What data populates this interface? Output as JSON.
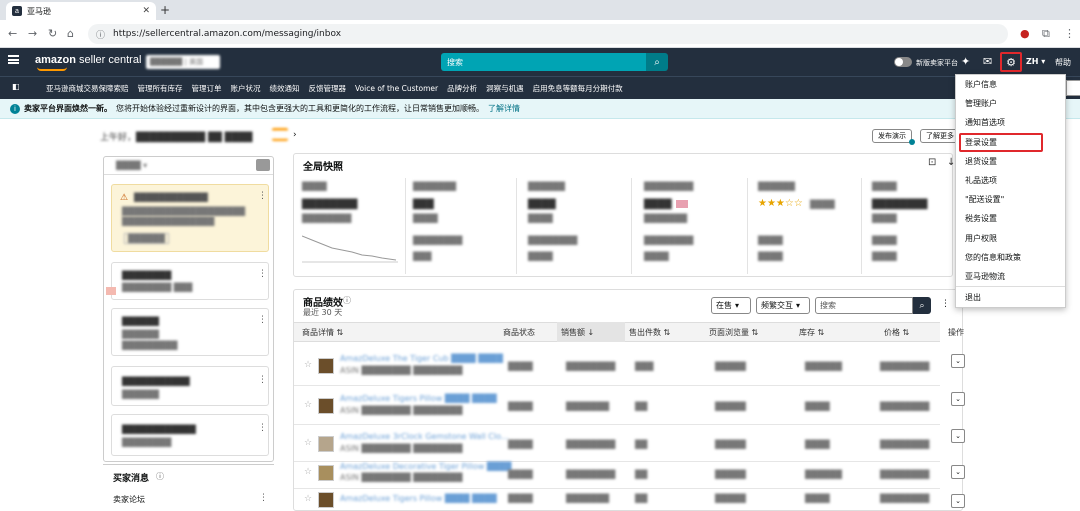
{
  "browser": {
    "tab_title": "亚马逊",
    "url": "https://sellercentral.amazon.com/messaging/inbox"
  },
  "header": {
    "logo_main": "amazon",
    "logo_sub": " seller central",
    "store_selector": "██████ | 美国",
    "search_placeholder": "搜索",
    "new_ui_toggle_label": "新版卖家平台",
    "language": "ZH ▾",
    "help": "帮助"
  },
  "subnav": [
    "亚马逊商城交易保障索赔",
    "管理所有库存",
    "管理订单",
    "账户状况",
    "绩效通知",
    "反馈管理器",
    "Voice of the Customer",
    "品牌分析",
    "洞察与机遇",
    "启用免息等额每月分期付款"
  ],
  "banner": {
    "title": "卖家平台界面焕然一新。",
    "text": "您将开始体验经过重新设计的界面，其中包含更强大的工具和更简化的工作流程，让日常销售更加顺畅。",
    "link": "了解详情"
  },
  "greeting": {
    "text": "上午好，██████████ ██ ████",
    "badge": "████",
    "publish_btn": "发布演示",
    "learn_more_btn": "了解更多"
  },
  "left_panel": {
    "header": "████ ▾",
    "cards": [
      {
        "title": "████████████",
        "lines": [
          "████████████████████",
          "███████████████",
          "██████"
        ]
      },
      {
        "title": "████████",
        "lines": [
          "████████ ███"
        ]
      },
      {
        "title": "██████",
        "lines": [
          "██████",
          "█████████"
        ]
      },
      {
        "title": "███████████",
        "lines": [
          "██████"
        ]
      },
      {
        "title": "████████████",
        "lines": [
          "████████"
        ]
      }
    ],
    "seller_messages": "买家消息",
    "forum": "卖家论坛"
  },
  "snapshot": {
    "title": "全局快照",
    "cards": [
      {
        "label": "████",
        "value": "████████",
        "sub": "████████",
        "label2": "",
        "value2": ""
      },
      {
        "label": "███████",
        "value": "███",
        "sub": "████",
        "label2": "████████",
        "value2": "███"
      },
      {
        "label": "██████",
        "value": "████",
        "sub": "████",
        "label2": "████████",
        "value2": "████"
      },
      {
        "label": "████████",
        "value": "████",
        "sub": "███████",
        "label2": "████████",
        "value2": "████"
      },
      {
        "label": "██████",
        "value": "★★★☆☆ ████",
        "sub": "████",
        "label2": "████",
        "value2": "████"
      },
      {
        "label": "████",
        "value": "████████",
        "sub": "████",
        "label2": "████",
        "value2": "████"
      }
    ]
  },
  "performance": {
    "title": "商品绩效",
    "subtitle": "最近 30 天",
    "filter_status": "在售",
    "filter_channel": "频繁交互",
    "search_placeholder": "搜索",
    "columns": {
      "details": "商品详情",
      "status": "商品状态",
      "sales": "销售额",
      "units": "售出件数",
      "page_views": "页面浏览量",
      "inventory": "库存",
      "price": "价格",
      "actions": "操作"
    },
    "rows": [
      {
        "name": "AmazDeluxe The Tiger Cub ████ ████",
        "asin": "ASIN ████████ ████████",
        "status": "████",
        "sales": "████████",
        "units": "███",
        "views": "█████",
        "inv": "██████",
        "price": "████████"
      },
      {
        "name": "AmazDeluxe Tigers Pillow ████ ████",
        "asin": "ASIN ████████ ████████",
        "status": "████",
        "sales": "███████",
        "units": "██",
        "views": "█████",
        "inv": "████",
        "price": "████████"
      },
      {
        "name": "AmazDeluxe 3rClock Gemstone Wall Clo...",
        "asin": "ASIN ████████ ████████",
        "status": "████",
        "sales": "████████",
        "units": "██",
        "views": "█████",
        "inv": "████",
        "price": "████████"
      },
      {
        "name": "AmazDeluxe Decorative Tiger Pillow ████",
        "asin": "ASIN ████████ ████████",
        "status": "████",
        "sales": "████████",
        "units": "██",
        "views": "█████",
        "inv": "██████",
        "price": "████████"
      },
      {
        "name": "AmazDeluxe Tigers Pillow ████ ████",
        "asin": "ASIN ████████ ████████",
        "status": "████",
        "sales": "███████",
        "units": "██",
        "views": "█████",
        "inv": "████",
        "price": "████████"
      }
    ]
  },
  "settings_menu": {
    "items": [
      "账户信息",
      "管理账户",
      "通知首选项",
      "登录设置",
      "退货设置",
      "礼品选项",
      "\"配送设置\"",
      "税务设置",
      "用户权限",
      "您的信息和政策",
      "亚马逊物流"
    ],
    "logout": "退出",
    "highlighted": "登录设置"
  },
  "colors": {
    "header": "#232f3e",
    "accent": "#ff9900",
    "teal": "#008296",
    "highlight": "#e0282c"
  }
}
